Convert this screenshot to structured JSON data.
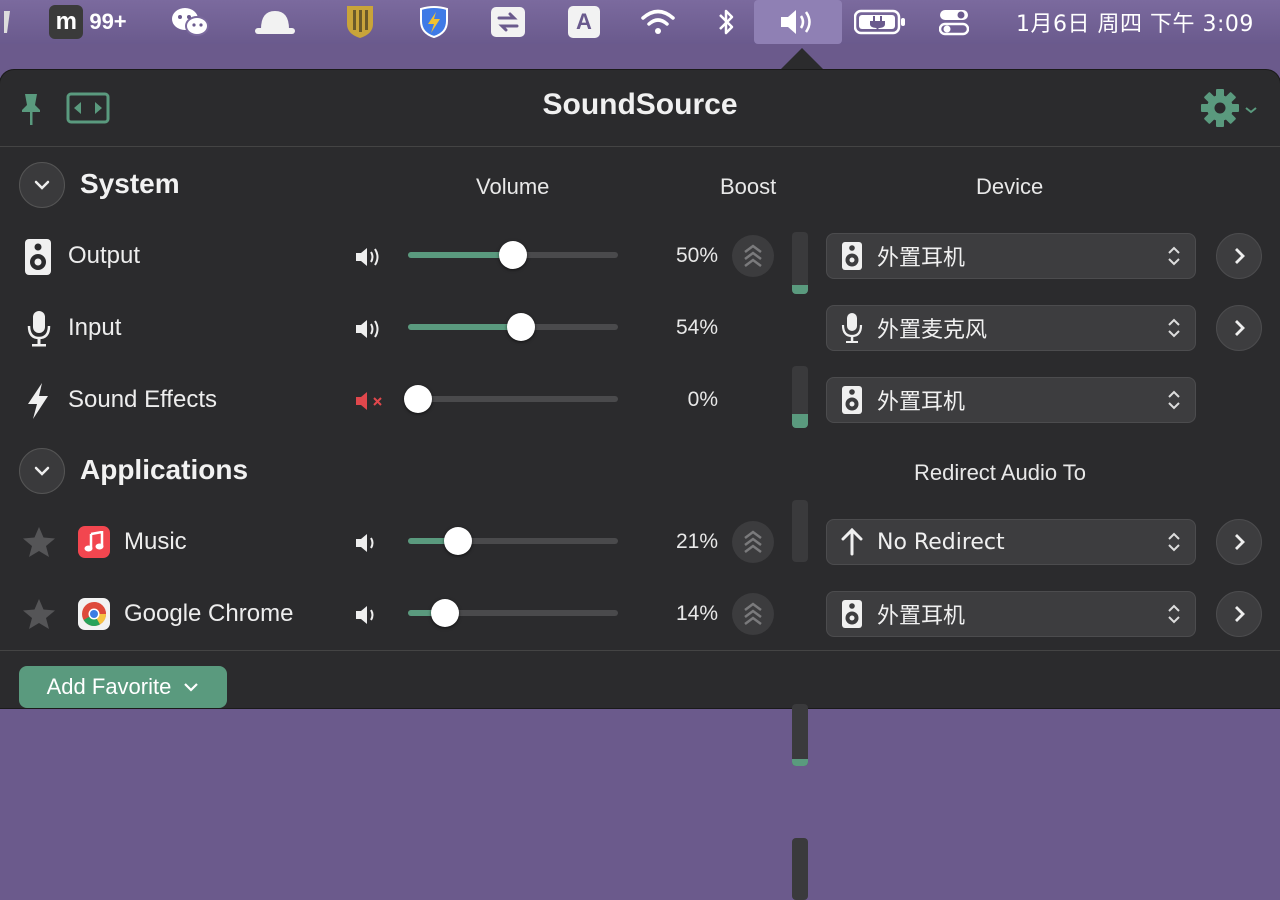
{
  "menubar": {
    "badge_count": "99+",
    "clock": "1月6日 周四 下午 3:09"
  },
  "popover": {
    "title": "SoundSource"
  },
  "system": {
    "title": "System",
    "col_volume": "Volume",
    "col_boost": "Boost",
    "col_device": "Device",
    "rows": [
      {
        "label": "Output",
        "percent": "50%",
        "volume": 0.5,
        "meter": 0.15,
        "device": "外置耳机",
        "device_icon": "speaker-icon"
      },
      {
        "label": "Input",
        "percent": "54%",
        "volume": 0.54,
        "meter": 0.22,
        "device": "外置麦克风",
        "device_icon": "microphone-icon"
      },
      {
        "label": "Sound Effects",
        "percent": "0%",
        "volume": 0.0,
        "meter": 0.0,
        "device": "外置耳机",
        "device_icon": "speaker-icon"
      }
    ]
  },
  "applications": {
    "title": "Applications",
    "col_redirect": "Redirect Audio To",
    "rows": [
      {
        "label": "Music",
        "percent": "21%",
        "volume": 0.21,
        "meter": 0.12,
        "redirect": "No Redirect"
      },
      {
        "label": "Google Chrome",
        "percent": "14%",
        "volume": 0.14,
        "meter": 0.0,
        "redirect": "外置耳机"
      }
    ]
  },
  "footer": {
    "add_favorite": "Add Favorite"
  },
  "colors": {
    "accent": "#5a9a7e",
    "muted_red": "#e0474c",
    "music_red": "#f2464f"
  }
}
